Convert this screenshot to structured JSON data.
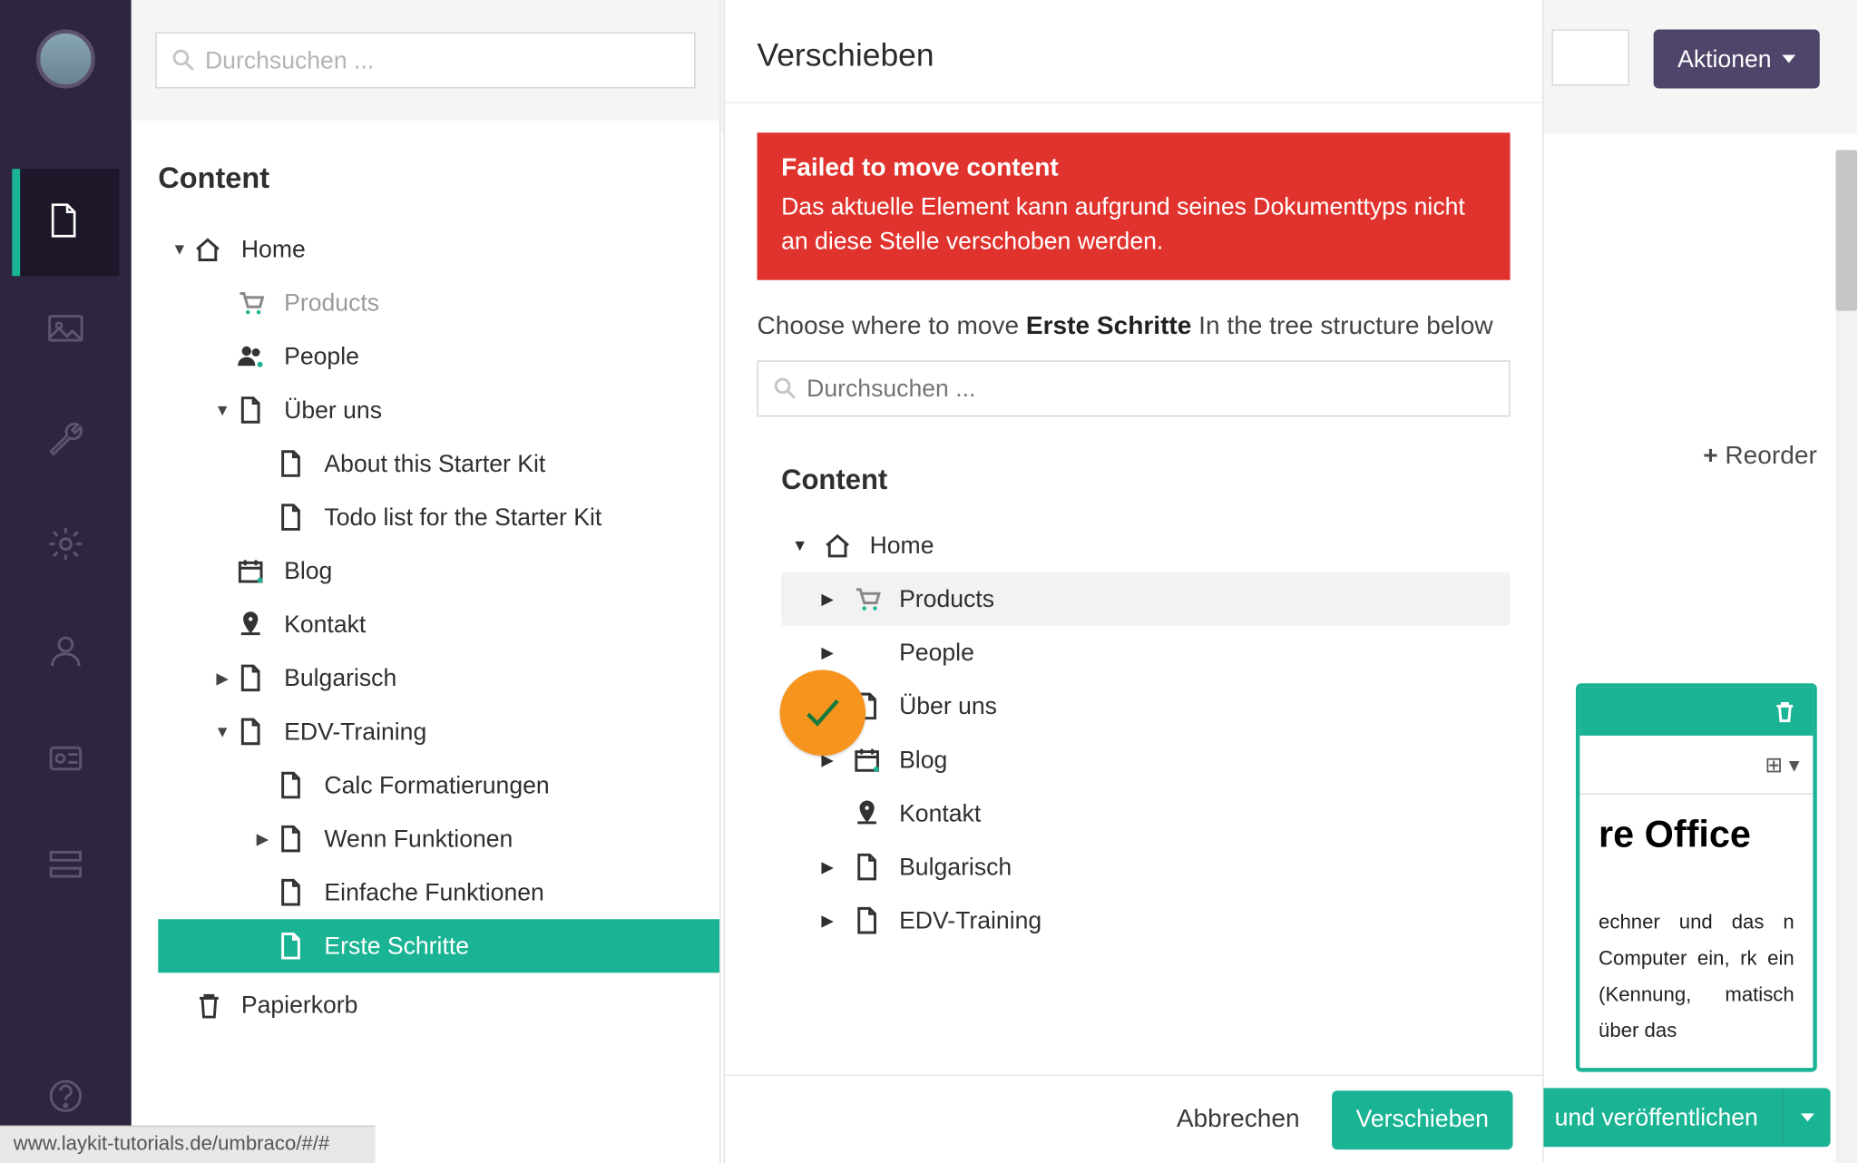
{
  "leftSearch": {
    "placeholder": "Durchsuchen ..."
  },
  "tree": {
    "title": "Content",
    "home": "Home",
    "products": "Products",
    "people": "People",
    "uber": "Über uns",
    "uber_about": "About this Starter Kit",
    "uber_todo": "Todo list for the Starter Kit",
    "blog": "Blog",
    "kontakt": "Kontakt",
    "bulgarisch": "Bulgarisch",
    "edv": "EDV-Training",
    "edv_calc": "Calc Formatierungen",
    "edv_wenn": "Wenn Funktionen",
    "edv_einfache": "Einfache Funktionen",
    "edv_erste": "Erste Schritte",
    "papierkorb": "Papierkorb"
  },
  "topbar": {
    "actions": "Aktionen"
  },
  "reorder": "Reorder",
  "editor": {
    "title": "re Office",
    "para": "echner und das n Computer ein, rk ein (Kennung, matisch über das"
  },
  "publish": "und veröffentlichen",
  "modal": {
    "title": "Verschieben",
    "alertTitle": "Failed to move content",
    "alertMsg": "Das aktuelle Element kann aufgrund seines Dokumenttyps nicht an diese Stelle verschoben werden.",
    "choosePre": "Choose where to move ",
    "chooseItem": "Erste Schritte",
    "choosePost": " In the tree structure below",
    "searchPlaceholder": "Durchsuchen ...",
    "treeTitle": "Content",
    "home": "Home",
    "products": "Products",
    "people": "People",
    "uber": "Über uns",
    "blog": "Blog",
    "kontakt": "Kontakt",
    "bulgarisch": "Bulgarisch",
    "edv": "EDV-Training",
    "cancel": "Abbrechen",
    "move": "Verschieben"
  },
  "statusbar": "www.laykit-tutorials.de/umbraco/#/#"
}
